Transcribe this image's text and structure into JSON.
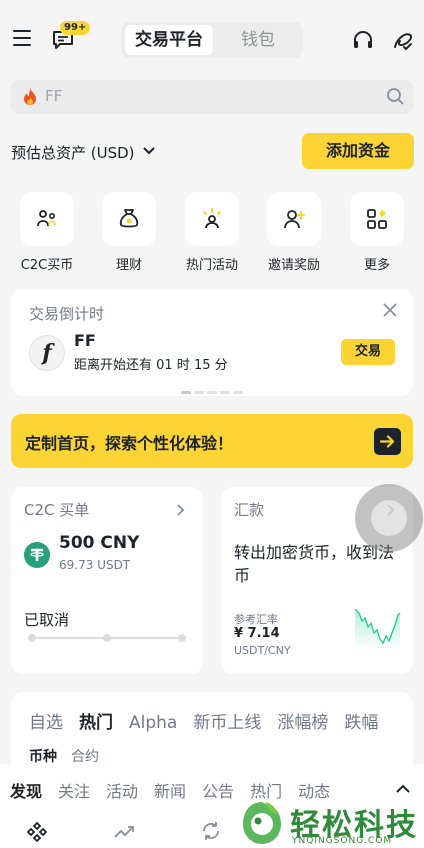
{
  "header": {
    "badge": "99+",
    "tabs": [
      {
        "label": "交易平台",
        "active": true
      },
      {
        "label": "钱包",
        "active": false
      }
    ]
  },
  "search": {
    "placeholder": "FF"
  },
  "assets": {
    "label": "预估总资产 (USD)",
    "add_funds": "添加资金"
  },
  "quick_actions": [
    {
      "label": "C2C买币",
      "icon": "c2c-icon"
    },
    {
      "label": "理财",
      "icon": "money-bag-icon"
    },
    {
      "label": "热门活动",
      "icon": "celebration-icon"
    },
    {
      "label": "邀请奖励",
      "icon": "invite-user-icon"
    },
    {
      "label": "更多",
      "icon": "grid-more-icon"
    }
  ],
  "countdown": {
    "title": "交易倒计时",
    "coin": "FF",
    "subtitle": "距离开始还有 01 时 15 分",
    "trade_button": "交易",
    "logo_text": "f"
  },
  "banner": {
    "text": "定制首页，探索个性化体验！"
  },
  "c2c": {
    "title": "C2C 买单",
    "amount": "500 CNY",
    "usdt": "69.73 USDT",
    "status": "已取消"
  },
  "remittance": {
    "title": "汇款",
    "description": "转出加密货币，收到法币",
    "ref_label": "参考汇率",
    "rate": "¥ 7.14",
    "pair": "USDT/CNY"
  },
  "markets": {
    "tabs": [
      {
        "label": "自选",
        "active": false
      },
      {
        "label": "热门",
        "active": true
      },
      {
        "label": "Alpha",
        "active": false
      },
      {
        "label": "新币上线",
        "active": false
      },
      {
        "label": "涨幅榜",
        "active": false
      },
      {
        "label": "跌幅",
        "active": false
      }
    ],
    "subtabs": [
      {
        "label": "币种",
        "active": true
      },
      {
        "label": "合约",
        "active": false
      }
    ]
  },
  "feed": {
    "tabs": [
      {
        "label": "发现",
        "active": true
      },
      {
        "label": "关注",
        "active": false
      },
      {
        "label": "活动",
        "active": false
      },
      {
        "label": "新闻",
        "active": false
      },
      {
        "label": "公告",
        "active": false
      },
      {
        "label": "热门",
        "active": false
      },
      {
        "label": "动态",
        "active": false
      }
    ]
  },
  "watermark": {
    "text": "轻松科技",
    "sub": "YNQINGSONG.COM"
  },
  "colors": {
    "accent": "#fcd535",
    "text": "#1e2329",
    "muted": "#707a8a",
    "usdt": "#26a17b",
    "spark": "#0ecb81"
  }
}
